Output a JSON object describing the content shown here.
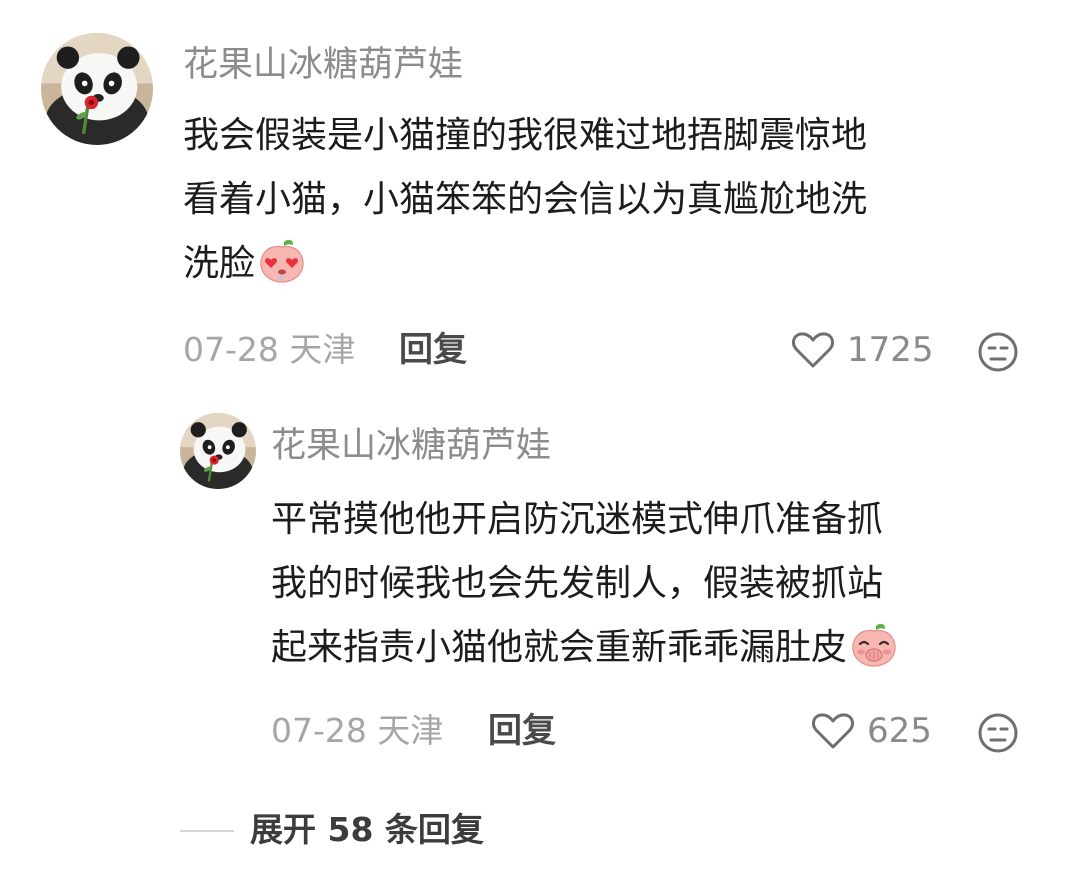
{
  "comments": [
    {
      "username": "花果山冰糖葫芦娃",
      "content_lines": [
        "我会假装是小猫撞的我很难过地捂脚震惊地",
        "看着小猫，小猫笨笨的会信以为真尴尬地洗",
        "洗脸"
      ],
      "emoji": "peach-heart-eyes-emoji",
      "date_location": "07-28 天津",
      "reply_label": "回复",
      "like_count": "1725",
      "like_icon": "heart-outline-icon",
      "dislike_icon": "meh-face-icon"
    },
    {
      "username": "花果山冰糖葫芦娃",
      "content_lines": [
        "平常摸他他开启防沉迷模式伸爪准备抓",
        "我的时候我也会先发制人，假装被抓站",
        "起来指责小猫他就会重新乖乖漏肚皮"
      ],
      "emoji": "peach-cover-mouth-emoji",
      "date_location": "07-28 天津",
      "reply_label": "回复",
      "like_count": "625",
      "like_icon": "heart-outline-icon",
      "dislike_icon": "meh-face-icon"
    }
  ],
  "expand_replies": {
    "label": "展开 58 条回复"
  },
  "colors": {
    "username": "#8c8c8c",
    "content": "#1c1c1c",
    "meta": "#a6a6a6",
    "reply": "#4a4a4a"
  }
}
